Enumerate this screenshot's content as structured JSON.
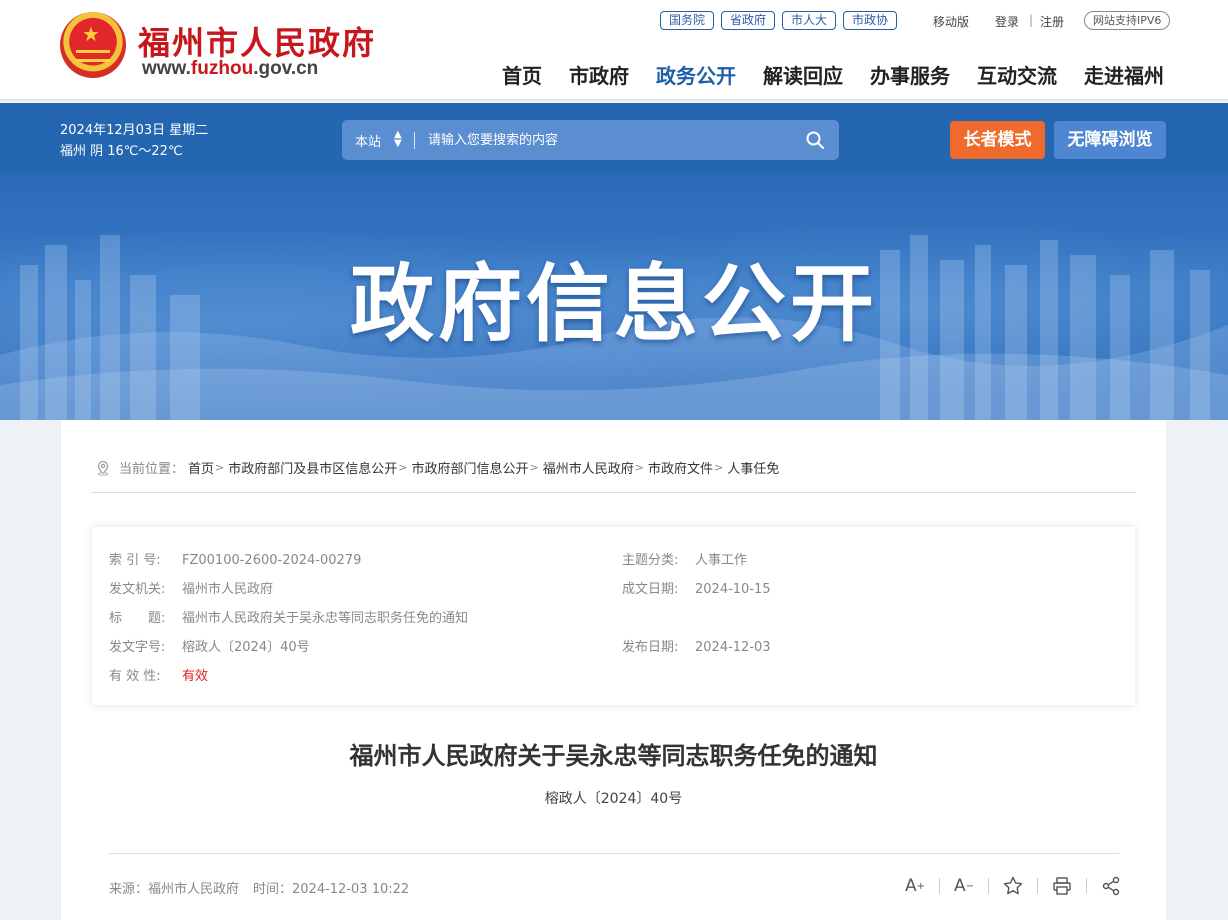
{
  "header": {
    "site_title": "福州市人民政府",
    "url_prefix": "www.",
    "url_brand": "fuzhou",
    "url_suffix": ".gov.cn",
    "top_links": [
      "国务院",
      "省政府",
      "市人大",
      "市政协"
    ],
    "mobile": "移动版",
    "login": "登录",
    "separator": "|",
    "register": "注册",
    "ipv6": "网站支持IPV6",
    "nav": [
      {
        "label": "首页",
        "active": false
      },
      {
        "label": "市政府",
        "active": false
      },
      {
        "label": "政务公开",
        "active": true
      },
      {
        "label": "解读回应",
        "active": false
      },
      {
        "label": "办事服务",
        "active": false
      },
      {
        "label": "互动交流",
        "active": false
      },
      {
        "label": "走进福州",
        "active": false
      }
    ]
  },
  "strip": {
    "date": "2024年12月03日 星期二",
    "weather": "福州 阴 16℃～22℃",
    "search_scope": "本站",
    "search_placeholder": "请输入您要搜索的内容",
    "elder_mode": "长者模式",
    "accessible": "无障碍浏览"
  },
  "banner": {
    "title": "政府信息公开"
  },
  "breadcrumb": {
    "prefix": "当前位置：",
    "items": [
      "首页",
      "市政府部门及县市区信息公开",
      "市政府部门信息公开",
      "福州市人民政府",
      "市政府文件",
      "人事任免"
    ],
    "sep": ">"
  },
  "meta": {
    "index_k": "索 引 号:",
    "index_v": "FZ00100-2600-2024-00279",
    "topic_k": "主题分类:",
    "topic_v": "人事工作",
    "issuer_k": "发文机关:",
    "issuer_v": "福州市人民政府",
    "date_k": "成文日期:",
    "date_v": "2024-10-15",
    "title_k": "标　　题:",
    "title_v": "福州市人民政府关于吴永忠等同志职务任免的通知",
    "docno_k": "发文字号:",
    "docno_v": "榕政人〔2024〕40号",
    "pub_k": "发布日期:",
    "pub_v": "2024-12-03",
    "valid_k": "有 效 性:",
    "valid_v": "有效"
  },
  "document": {
    "title": "福州市人民政府关于吴永忠等同志职务任免的通知",
    "number": "榕政人〔2024〕40号",
    "source": "来源：福州市人民政府",
    "time": "时间：2024-12-03 10:22"
  },
  "colors": {
    "brand_red": "#c8161d",
    "nav_blue": "#1f5fa8",
    "strip_blue": "#2566b0",
    "elder_orange": "#ef6a2d",
    "access_blue": "#4f86d2",
    "valid_red": "#e02020"
  }
}
